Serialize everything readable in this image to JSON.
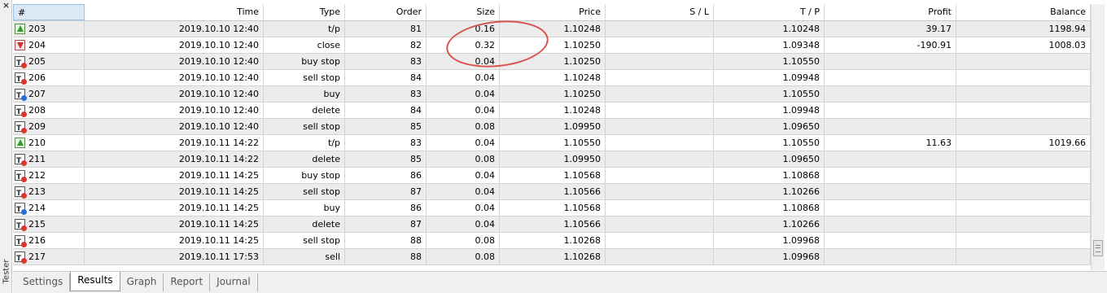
{
  "window": {
    "close_glyph": "×",
    "side_label": "Tester"
  },
  "table": {
    "headers": [
      "#",
      "Time",
      "Type",
      "Order",
      "Size",
      "Price",
      "S / L",
      "T / P",
      "Profit",
      "Balance"
    ],
    "rows": [
      {
        "icon": "take-profit-icon",
        "num": "203",
        "time": "2019.10.10 12:40",
        "type": "t/p",
        "order": "81",
        "size": "0.16",
        "price": "1.10248",
        "sl": "",
        "tp": "1.10248",
        "profit": "39.17",
        "balance": "1198.94"
      },
      {
        "icon": "close-icon",
        "num": "204",
        "time": "2019.10.10 12:40",
        "type": "close",
        "order": "82",
        "size": "0.32",
        "price": "1.10250",
        "sl": "",
        "tp": "1.09348",
        "profit": "-190.91",
        "balance": "1008.03"
      },
      {
        "icon": "pending-order-red-icon",
        "num": "205",
        "time": "2019.10.10 12:40",
        "type": "buy stop",
        "order": "83",
        "size": "0.04",
        "price": "1.10250",
        "sl": "",
        "tp": "1.10550",
        "profit": "",
        "balance": ""
      },
      {
        "icon": "pending-order-red-icon",
        "num": "206",
        "time": "2019.10.10 12:40",
        "type": "sell stop",
        "order": "84",
        "size": "0.04",
        "price": "1.10248",
        "sl": "",
        "tp": "1.09948",
        "profit": "",
        "balance": ""
      },
      {
        "icon": "pending-order-blue-icon",
        "num": "207",
        "time": "2019.10.10 12:40",
        "type": "buy",
        "order": "83",
        "size": "0.04",
        "price": "1.10250",
        "sl": "",
        "tp": "1.10550",
        "profit": "",
        "balance": ""
      },
      {
        "icon": "pending-order-red-icon",
        "num": "208",
        "time": "2019.10.10 12:40",
        "type": "delete",
        "order": "84",
        "size": "0.04",
        "price": "1.10248",
        "sl": "",
        "tp": "1.09948",
        "profit": "",
        "balance": ""
      },
      {
        "icon": "pending-order-red-icon",
        "num": "209",
        "time": "2019.10.10 12:40",
        "type": "sell stop",
        "order": "85",
        "size": "0.08",
        "price": "1.09950",
        "sl": "",
        "tp": "1.09650",
        "profit": "",
        "balance": ""
      },
      {
        "icon": "take-profit-icon",
        "num": "210",
        "time": "2019.10.11 14:22",
        "type": "t/p",
        "order": "83",
        "size": "0.04",
        "price": "1.10550",
        "sl": "",
        "tp": "1.10550",
        "profit": "11.63",
        "balance": "1019.66"
      },
      {
        "icon": "pending-order-red-icon",
        "num": "211",
        "time": "2019.10.11 14:22",
        "type": "delete",
        "order": "85",
        "size": "0.08",
        "price": "1.09950",
        "sl": "",
        "tp": "1.09650",
        "profit": "",
        "balance": ""
      },
      {
        "icon": "pending-order-red-icon",
        "num": "212",
        "time": "2019.10.11 14:25",
        "type": "buy stop",
        "order": "86",
        "size": "0.04",
        "price": "1.10568",
        "sl": "",
        "tp": "1.10868",
        "profit": "",
        "balance": ""
      },
      {
        "icon": "pending-order-red-icon",
        "num": "213",
        "time": "2019.10.11 14:25",
        "type": "sell stop",
        "order": "87",
        "size": "0.04",
        "price": "1.10566",
        "sl": "",
        "tp": "1.10266",
        "profit": "",
        "balance": ""
      },
      {
        "icon": "pending-order-blue-icon",
        "num": "214",
        "time": "2019.10.11 14:25",
        "type": "buy",
        "order": "86",
        "size": "0.04",
        "price": "1.10568",
        "sl": "",
        "tp": "1.10868",
        "profit": "",
        "balance": ""
      },
      {
        "icon": "pending-order-red-icon",
        "num": "215",
        "time": "2019.10.11 14:25",
        "type": "delete",
        "order": "87",
        "size": "0.04",
        "price": "1.10566",
        "sl": "",
        "tp": "1.10266",
        "profit": "",
        "balance": ""
      },
      {
        "icon": "pending-order-red-icon",
        "num": "216",
        "time": "2019.10.11 14:25",
        "type": "sell stop",
        "order": "88",
        "size": "0.08",
        "price": "1.10268",
        "sl": "",
        "tp": "1.09968",
        "profit": "",
        "balance": ""
      },
      {
        "icon": "pending-order-red-icon",
        "num": "217",
        "time": "2019.10.11 17:53",
        "type": "sell",
        "order": "88",
        "size": "0.08",
        "price": "1.10268",
        "sl": "",
        "tp": "1.09968",
        "profit": "",
        "balance": ""
      }
    ]
  },
  "tabs": [
    "Settings",
    "Results",
    "Graph",
    "Report",
    "Journal"
  ],
  "active_tab": "Results",
  "colors": {
    "highlight_ring": "#d9534f",
    "alt_row": "#ececec",
    "header_selected": "#dbe8f5"
  }
}
